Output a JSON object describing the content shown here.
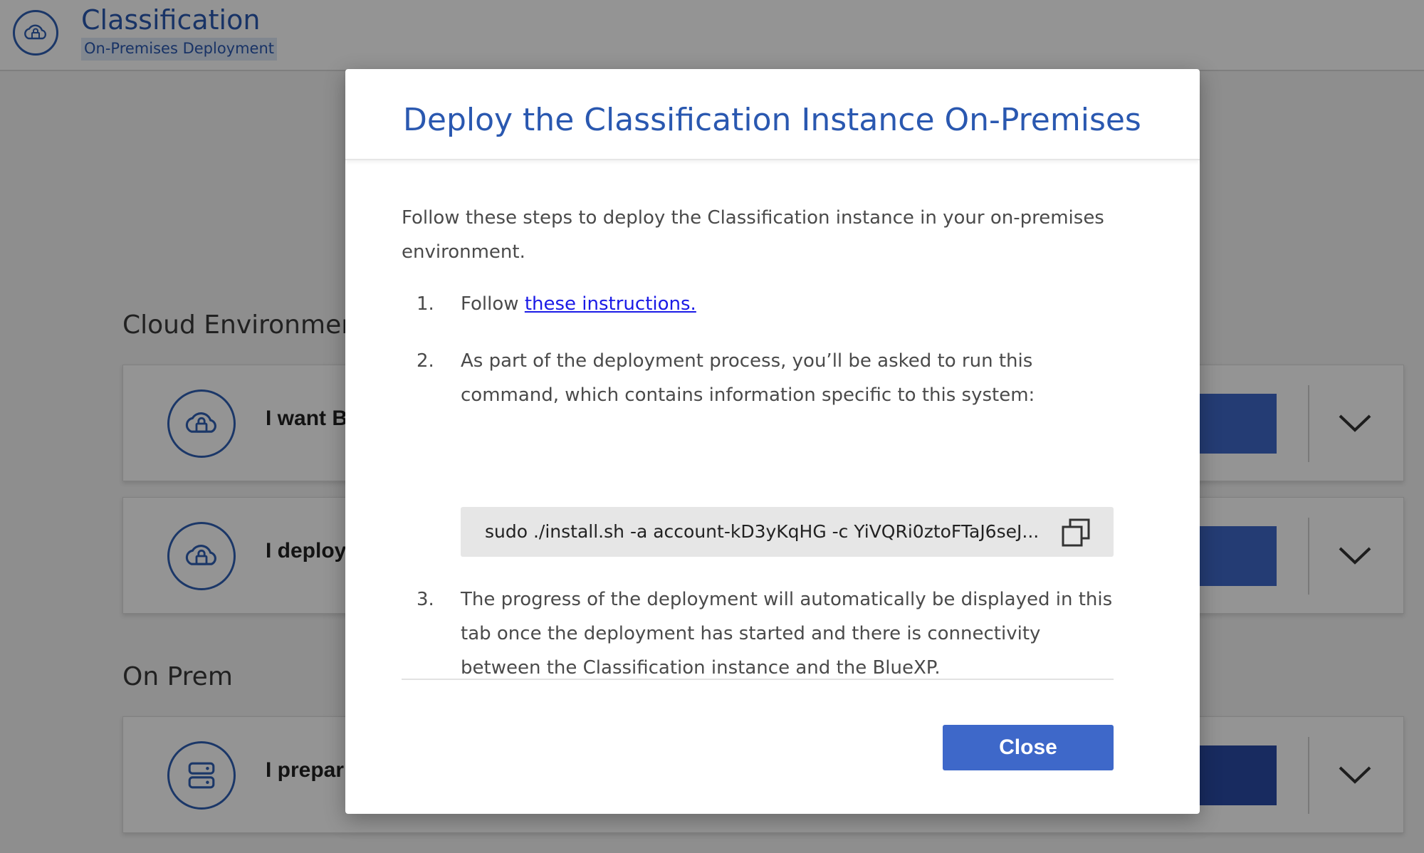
{
  "header": {
    "title": "Classification",
    "subtitle": "On-Premises Deployment",
    "icon": "cloud-lock-icon"
  },
  "background": {
    "sections": [
      {
        "label": "Cloud Environmen"
      },
      {
        "label": "On Prem"
      }
    ],
    "cards": [
      {
        "label": "I want B",
        "icon": "cloud-lock-icon"
      },
      {
        "label": "I deploy",
        "icon": "cloud-lock-icon"
      },
      {
        "label": "I prepar",
        "icon": "server-icon"
      }
    ]
  },
  "modal": {
    "title": "Deploy the Classification Instance On-Premises",
    "intro": "Follow these steps to deploy the Classification instance in your on-premises environment.",
    "steps": [
      {
        "number": "1.",
        "prefix": "Follow ",
        "link": "these instructions."
      },
      {
        "number": "2.",
        "text": "As part of the deployment process, you’ll be asked to run this command, which contains information specific to this system:"
      },
      {
        "number": "3.",
        "text": "The progress of the deployment will automatically be displayed in this tab once the deployment has started and there is connectivity between the Classification instance and the BlueXP."
      }
    ],
    "command": "sudo ./install.sh -a account-kD3yKqHG -c YiVQRi0ztoFTaJ6seJ...",
    "copy_icon": "copy-icon",
    "close_label": "Close"
  },
  "colors": {
    "accent": "#3e68c9",
    "title_blue": "#2a58b0",
    "link": "#1a1ae6"
  }
}
